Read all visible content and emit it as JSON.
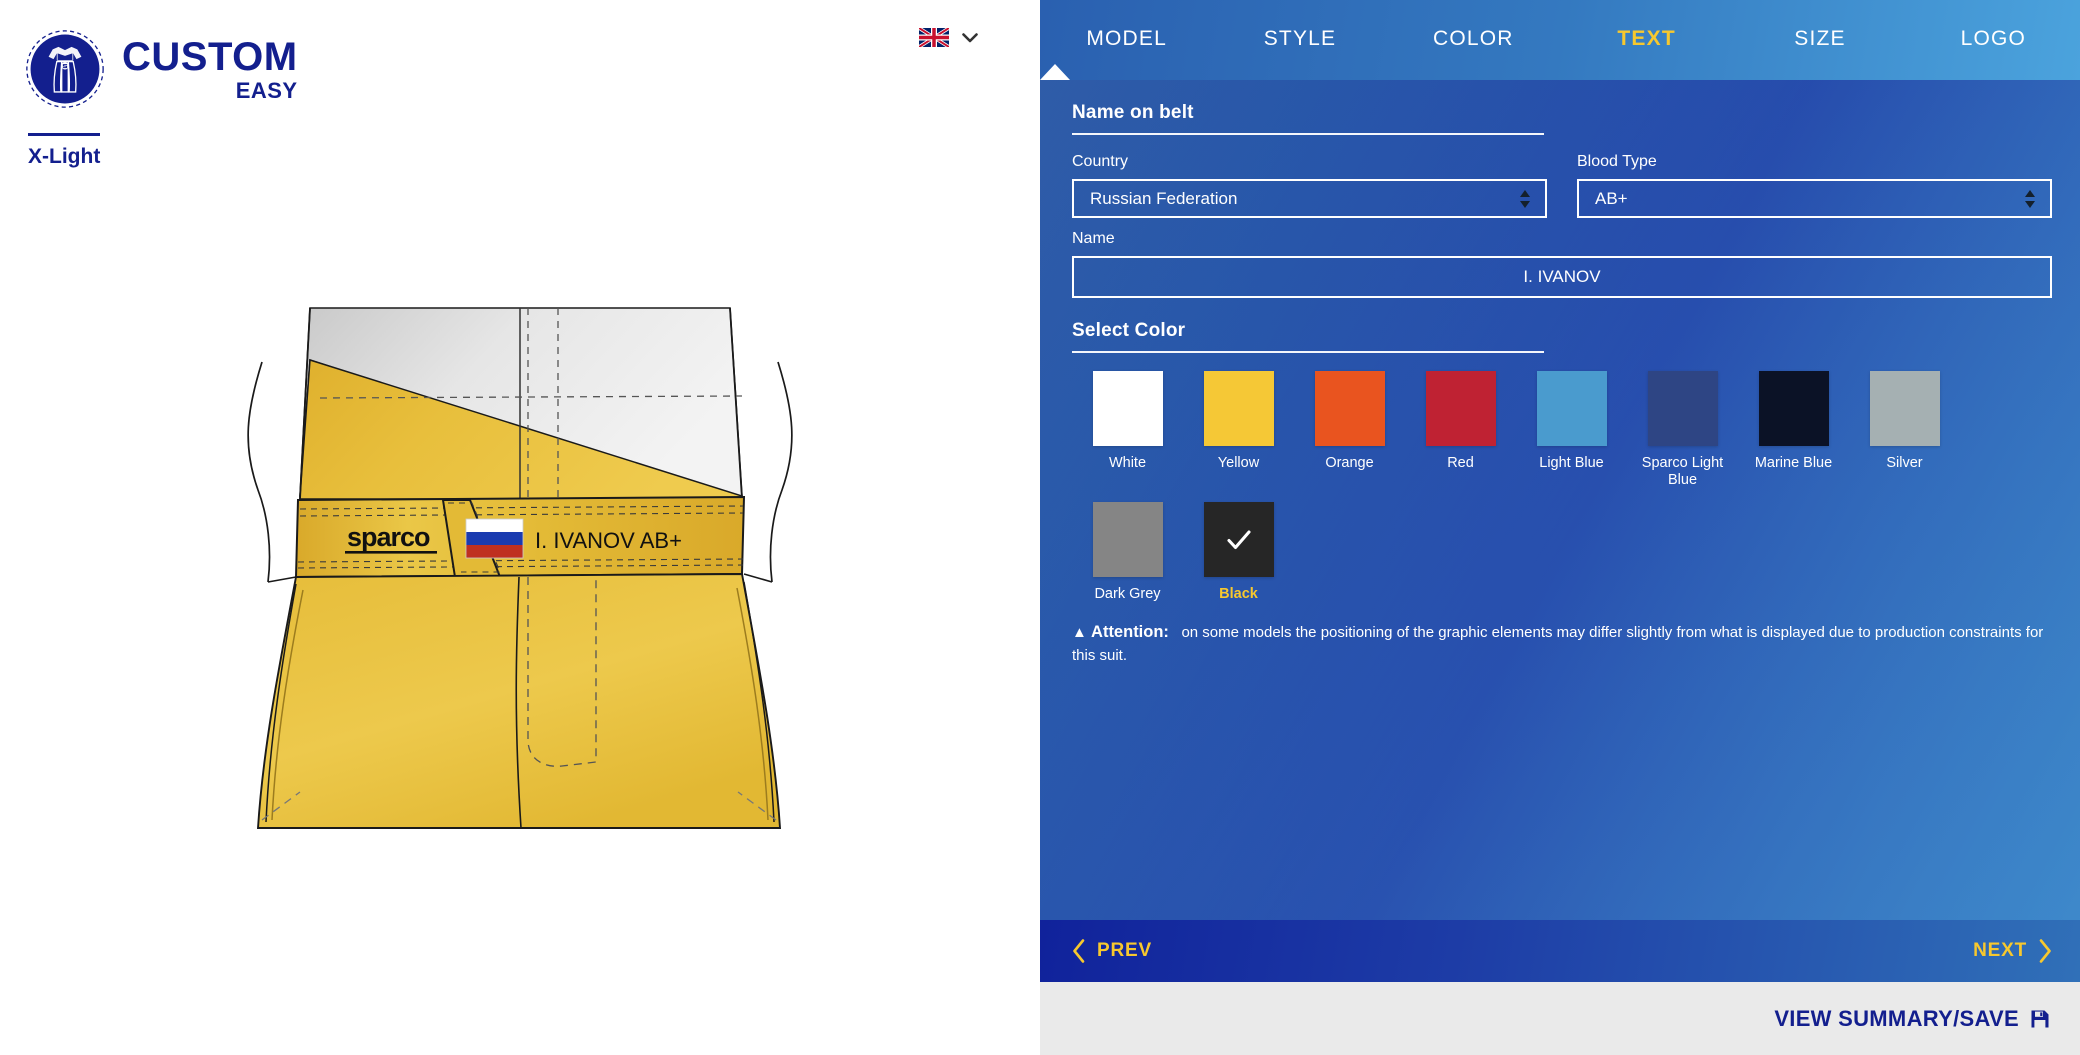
{
  "brand": {
    "title": "CUSTOM",
    "subtitle": "EASY",
    "logo_icon": "racing-suit-circle-logo",
    "model_label": "X-Light"
  },
  "language": {
    "flag_icon": "uk-flag-icon",
    "chevron_icon": "chevron-down-icon"
  },
  "tabs": [
    {
      "label": "MODEL",
      "active": false
    },
    {
      "label": "STYLE",
      "active": false
    },
    {
      "label": "COLOR",
      "active": false
    },
    {
      "label": "TEXT",
      "active": true
    },
    {
      "label": "SIZE",
      "active": false
    },
    {
      "label": "LOGO",
      "active": false
    }
  ],
  "name_on_belt": {
    "heading": "Name on belt",
    "country": {
      "label": "Country",
      "value": "Russian Federation",
      "options": [
        "Russian Federation"
      ]
    },
    "blood_type": {
      "label": "Blood Type",
      "value": "AB+",
      "options": [
        "AB+"
      ]
    },
    "name": {
      "label": "Name",
      "value": "I. IVANOV",
      "placeholder": "Name"
    }
  },
  "select_color": {
    "heading": "Select Color",
    "selected": "Black",
    "check_icon": "check-icon",
    "swatches": [
      {
        "name": "White",
        "hex": "#ffffff",
        "selected": false
      },
      {
        "name": "Yellow",
        "hex": "#f5c836",
        "selected": false
      },
      {
        "name": "Orange",
        "hex": "#e9541f",
        "selected": false
      },
      {
        "name": "Red",
        "hex": "#bf2233",
        "selected": false
      },
      {
        "name": "Light Blue",
        "hex": "#4a9bce",
        "selected": false
      },
      {
        "name": "Sparco Light Blue",
        "hex": "#2e4584",
        "selected": false
      },
      {
        "name": "Marine Blue",
        "hex": "#0b1226",
        "selected": false
      },
      {
        "name": "Silver",
        "hex": "#a5b0b2",
        "selected": false
      },
      {
        "name": "Dark Grey",
        "hex": "#858585",
        "selected": false
      },
      {
        "name": "Black",
        "hex": "#262626",
        "selected": true
      }
    ]
  },
  "attention": {
    "warn_icon": "warning-triangle-icon",
    "label": "Attention:",
    "text": "on some models the positioning of the graphic elements may differ slightly from what is displayed due to production constraints for this suit."
  },
  "step_nav": {
    "prev_label": "PREV",
    "next_label": "NEXT",
    "prev_icon": "chevron-left-icon",
    "next_icon": "chevron-right-icon"
  },
  "summary": {
    "label": "VIEW SUMMARY/SAVE",
    "icon": "save-disk-icon"
  },
  "preview": {
    "belt_brand": "sparco",
    "belt_flag_icon": "russia-flag-icon",
    "belt_name": "I. IVANOV",
    "belt_blood": "AB+",
    "suit_color_hex": "#e8bf3c",
    "suit_color_dark_hex": "#d9ad2c",
    "suit_panel_light_hex": "#e9e9e9"
  },
  "theme": {
    "brand_blue": "#131f8e",
    "accent_yellow": "#f7c82e",
    "panel_blue_dark": "#1a2f9c",
    "panel_blue_light": "#4ba3dd",
    "footer_grey": "#eaeaea"
  }
}
